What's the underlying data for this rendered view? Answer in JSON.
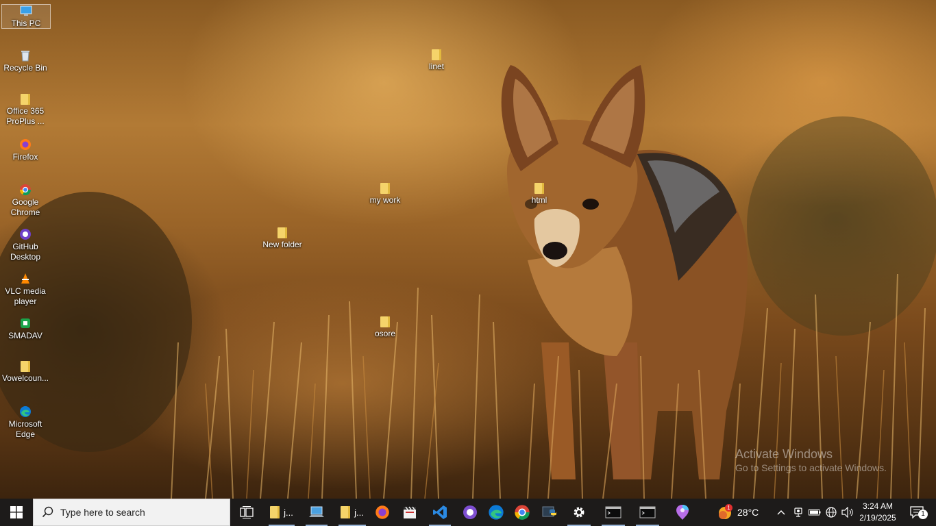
{
  "desktop": {
    "icons": [
      {
        "label": "This PC",
        "icon": "computer-icon"
      },
      {
        "label": "Recycle Bin",
        "icon": "recycle-bin-icon"
      },
      {
        "label": "Office 365 ProPlus ...",
        "icon": "folder-icon"
      },
      {
        "label": "Firefox",
        "icon": "firefox-icon"
      },
      {
        "label": "Google Chrome",
        "icon": "chrome-icon"
      },
      {
        "label": "GitHub Desktop",
        "icon": "github-desktop-icon"
      },
      {
        "label": "VLC media player",
        "icon": "vlc-icon"
      },
      {
        "label": "SMADAV",
        "icon": "smadav-icon"
      },
      {
        "label": "Vowelcoun...",
        "icon": "file-icon"
      },
      {
        "label": "Microsoft Edge",
        "icon": "edge-icon"
      },
      {
        "label": "linet",
        "icon": "folder-icon"
      },
      {
        "label": "my work",
        "icon": "folder-icon"
      },
      {
        "label": "html",
        "icon": "folder-icon"
      },
      {
        "label": "New folder",
        "icon": "folder-icon"
      },
      {
        "label": "osore",
        "icon": "folder-icon"
      }
    ]
  },
  "watermark": {
    "title": "Activate Windows",
    "subtitle": "Go to Settings to activate Windows."
  },
  "taskbar": {
    "search_placeholder": "Type here to search",
    "apps": [
      {
        "label": "j...",
        "icon": "file-explorer-icon"
      },
      {
        "label": "",
        "icon": "remote-desktop-icon"
      },
      {
        "label": "j...",
        "icon": "file-explorer-icon"
      },
      {
        "label": "",
        "icon": "firefox-icon"
      },
      {
        "label": "",
        "icon": "clapperboard-icon"
      },
      {
        "label": "",
        "icon": "vscode-icon"
      },
      {
        "label": "",
        "icon": "github-icon"
      },
      {
        "label": "",
        "icon": "edge-icon"
      },
      {
        "label": "",
        "icon": "chrome-icon"
      },
      {
        "label": "",
        "icon": "python-icon"
      },
      {
        "label": "",
        "icon": "settings-gear-icon"
      },
      {
        "label": "",
        "icon": "terminal-icon"
      },
      {
        "label": "",
        "icon": "terminal-icon"
      },
      {
        "label": "",
        "icon": "copilot-icon"
      }
    ],
    "weather": {
      "temp": "28°C",
      "badge": "1"
    },
    "clock": {
      "time": "3:24 AM",
      "date": "2/19/2025"
    },
    "notifications": {
      "count": "1"
    }
  },
  "colors": {
    "taskbar_bg": "#1d1b1a",
    "folder": "#f5d46a",
    "active_indicator": "#9ab6d8"
  }
}
